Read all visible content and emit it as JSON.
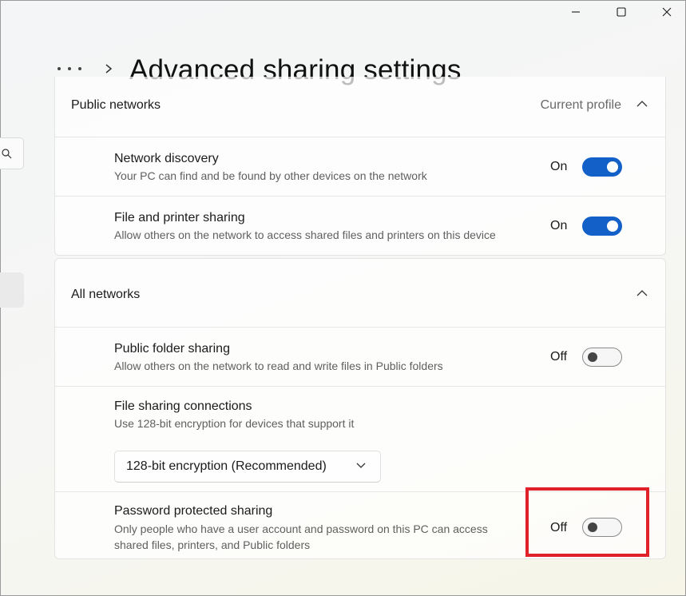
{
  "window": {
    "controls": {
      "minimize_icon": "minimize-icon",
      "maximize_icon": "maximize-icon",
      "close_icon": "close-icon"
    }
  },
  "header": {
    "more_icon": "more-horizontal-icon",
    "separator_icon": "chevron-right-icon",
    "title": "Advanced sharing settings"
  },
  "public_networks": {
    "title": "Public networks",
    "profile_label": "Current profile",
    "expanded": true,
    "settings": [
      {
        "title": "Network discovery",
        "description": "Your PC can find and be found by other devices on the network",
        "state": "On",
        "on": true
      },
      {
        "title": "File and printer sharing",
        "description": "Allow others on the network to access shared files and printers on this device",
        "state": "On",
        "on": true
      }
    ]
  },
  "all_networks": {
    "title": "All networks",
    "expanded": true,
    "public_folder": {
      "title": "Public folder sharing",
      "description": "Allow others on the network to read and write files in Public folders",
      "state": "Off",
      "on": false
    },
    "file_sharing": {
      "title": "File sharing connections",
      "description": "Use 128-bit encryption for devices that support it",
      "dropdown_value": "128-bit encryption (Recommended)"
    },
    "password_sharing": {
      "title": "Password protected sharing",
      "description_line1": "Only people who have a user account and password on this PC can access",
      "description_line2": "shared files, printers, and Public folders",
      "state": "Off",
      "on": false
    }
  },
  "annotation": {
    "highlight_color": "#e0212a"
  },
  "colors": {
    "toggle_on": "#1260c8",
    "text_primary": "#1b1b1b",
    "text_secondary": "#5f5f5f"
  }
}
